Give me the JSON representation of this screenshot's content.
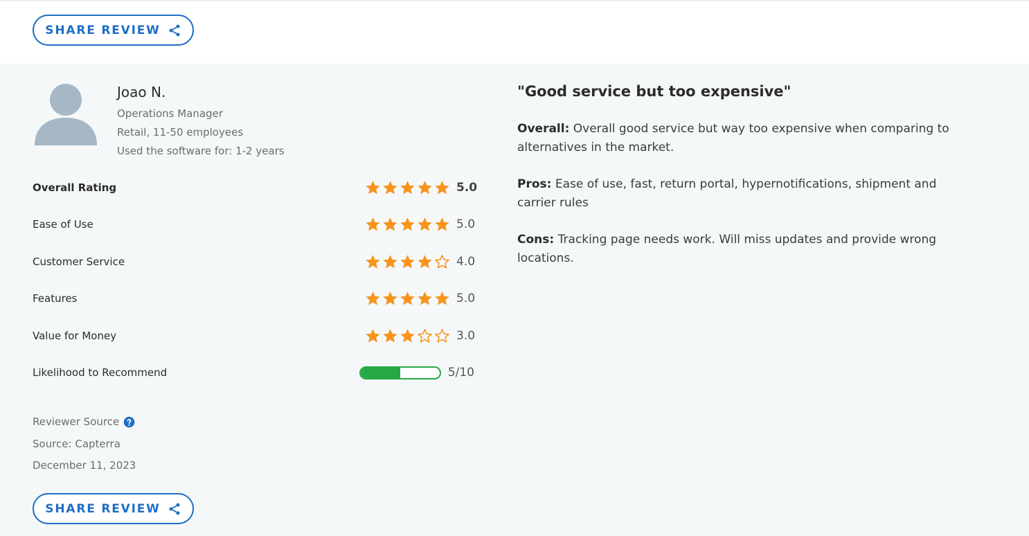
{
  "share_button": {
    "label": "SHARE REVIEW",
    "icon": "share-icon"
  },
  "reviewer": {
    "name": "Joao N.",
    "role": "Operations Manager",
    "company": "Retail, 11-50 employees",
    "usage": "Used the software for: 1-2 years",
    "avatar_icon": "user-avatar-icon"
  },
  "ratings": [
    {
      "label": "Overall Rating",
      "stars": 5,
      "value": "5.0"
    },
    {
      "label": "Ease of Use",
      "stars": 5,
      "value": "5.0"
    },
    {
      "label": "Customer Service",
      "stars": 4,
      "value": "4.0"
    },
    {
      "label": "Features",
      "stars": 5,
      "value": "5.0"
    },
    {
      "label": "Value for Money",
      "stars": 3,
      "value": "3.0"
    }
  ],
  "recommend": {
    "label": "Likelihood to Recommend",
    "score": 5,
    "max": 10,
    "value": "5/10"
  },
  "source": {
    "title": "Reviewer Source",
    "help_icon": "help-circle-icon",
    "name": "Source: Capterra",
    "date": "December 11, 2023"
  },
  "review": {
    "title": "\"Good service but too expensive\"",
    "overall_label": "Overall:",
    "overall_text": " Overall good service but way too expensive when comparing to alternatives in the market.",
    "pros_label": "Pros:",
    "pros_text": " Ease of use, fast, return portal, hypernotifications, shipment and carrier rules",
    "cons_label": "Cons:",
    "cons_text": " Tracking page needs work. Will miss updates and provide wrong locations."
  },
  "colors": {
    "accent": "#1f6fc5",
    "star": "#f7941d",
    "progress": "#27a844",
    "panel_bg": "#f5f8f9",
    "avatar": "#a6b8c6"
  }
}
